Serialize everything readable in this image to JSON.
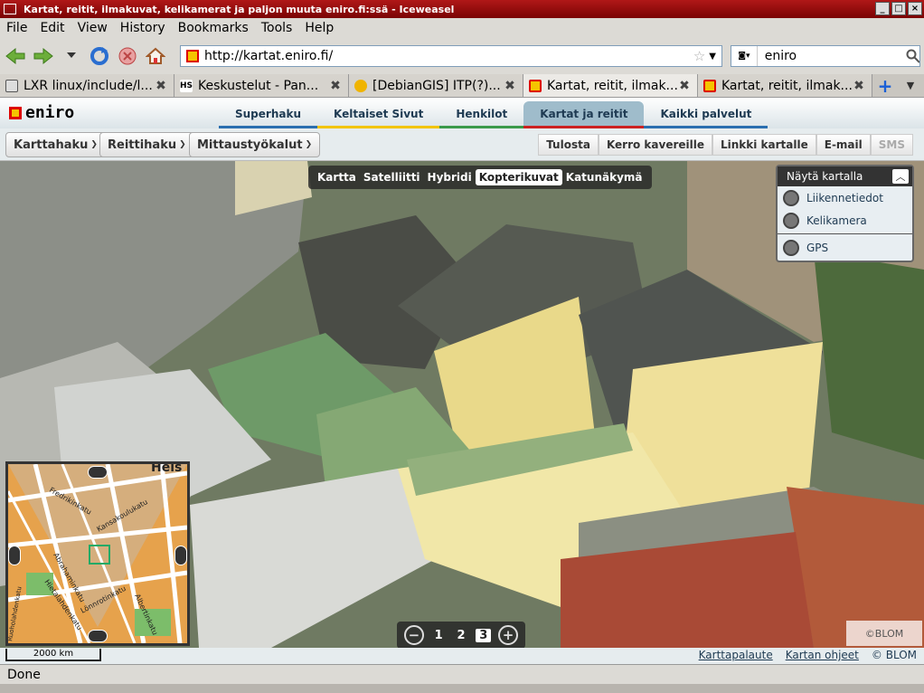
{
  "window": {
    "title": "Kartat, reitit, ilmakuvat, kelikamerat ja paljon muuta eniro.fi:ssä - Iceweasel"
  },
  "menu": [
    "File",
    "Edit",
    "View",
    "History",
    "Bookmarks",
    "Tools",
    "Help"
  ],
  "nav": {
    "url": "http://kartat.eniro.fi/",
    "search_value": "eniro"
  },
  "tabs": [
    {
      "label": "LXR linux/include/l..."
    },
    {
      "label": "Keskustelut - Pan..."
    },
    {
      "label": "[DebianGIS] ITP(?)..."
    },
    {
      "label": "Kartat, reitit, ilmak..."
    },
    {
      "label": "Kartat, reitit, ilmak..."
    }
  ],
  "site": {
    "logo": "eniro",
    "topnav": [
      {
        "label": "Superhaku",
        "color": "#2a6fb0"
      },
      {
        "label": "Keltaiset Sivut",
        "color": "#f2c400"
      },
      {
        "label": "Henkilot",
        "color": "#3a9a4a"
      },
      {
        "label": "Kartat ja reitit",
        "color": "#cc2222"
      },
      {
        "label": "Kaikki palvelut",
        "color": "#2a6fb0"
      }
    ],
    "tools": [
      "Karttahaku",
      "Reittihaku",
      "Mittaustyökalut"
    ],
    "actions": [
      "Tulosta",
      "Kerro kavereille",
      "Linkki kartalle",
      "E-mail",
      "SMS"
    ]
  },
  "map": {
    "types": [
      "Kartta",
      "Satelliitti",
      "Hybridi",
      "Kopterikuvat",
      "Katunäkymä"
    ],
    "selected_type": "Kopterikuvat",
    "panel": {
      "title": "Näytä kartalla",
      "items": [
        "Liikennetiedot",
        "Kelikamera",
        "GPS"
      ]
    },
    "zoom_levels": [
      "1",
      "2",
      "3"
    ],
    "selected_zoom": "3",
    "minimap_label": "Hels",
    "minimap_streets": [
      "Fredrikinkatu",
      "Kansakoulukatu",
      "Abrahaminkatu",
      "Hietalahdenkatu",
      "Lönnrotinkatu",
      "Albertinkatu",
      "Ruoholahdenkatu"
    ],
    "scale": "2000 km",
    "copyright_badge": "©BLOM",
    "footer_links": [
      "Karttapalaute",
      "Kartan ohjeet",
      "© BLOM"
    ]
  },
  "status": "Done"
}
